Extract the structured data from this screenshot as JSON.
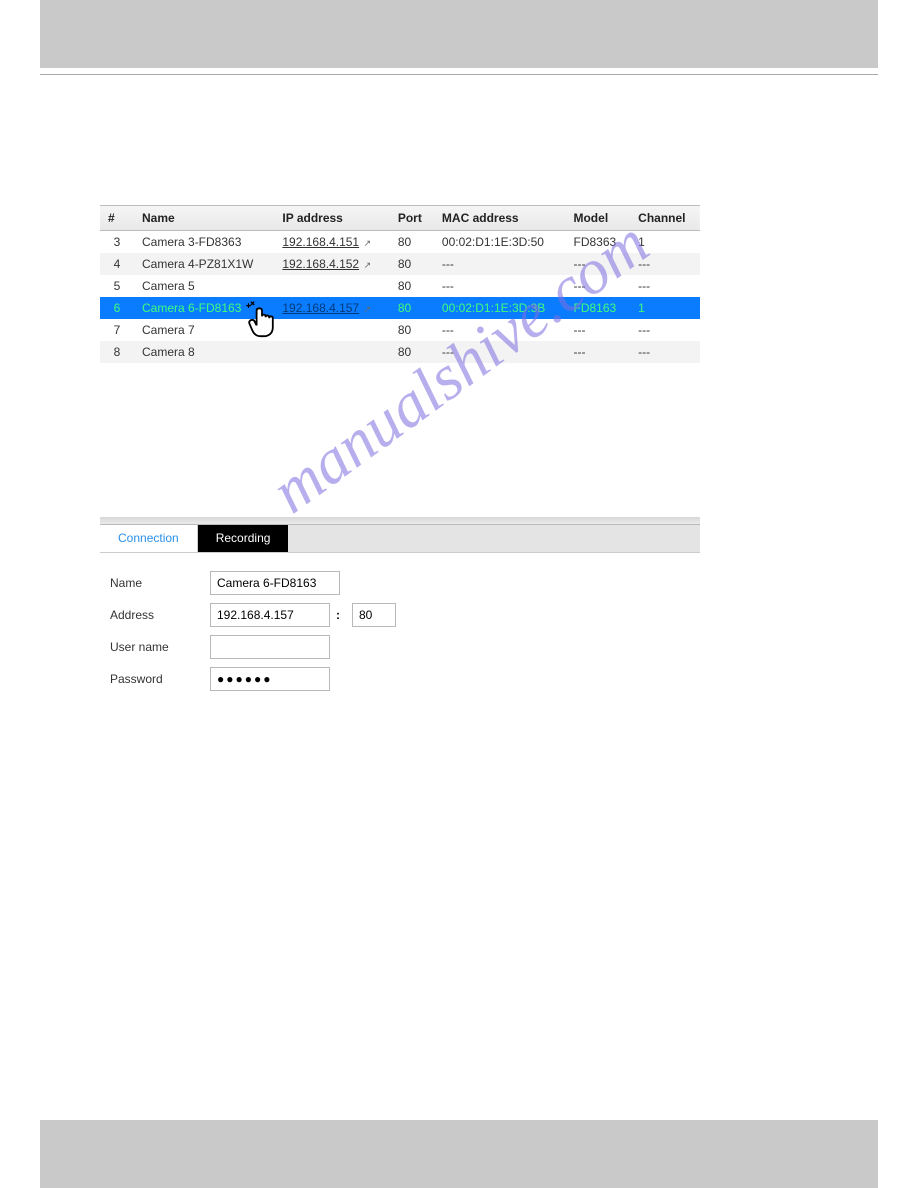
{
  "watermark": "manualshive.com",
  "table": {
    "headers": {
      "idx": "#",
      "name": "Name",
      "ip": "IP address",
      "port": "Port",
      "mac": "MAC address",
      "model": "Model",
      "channel": "Channel"
    },
    "rows": [
      {
        "idx": "3",
        "name": "Camera 3-FD8363",
        "ip": "192.168.4.151",
        "port": "80",
        "mac": "00:02:D1:1E:3D:50",
        "model": "FD8363",
        "channel": "1",
        "selected": false,
        "even": false
      },
      {
        "idx": "4",
        "name": "Camera 4-PZ81X1W",
        "ip": "192.168.4.152",
        "port": "80",
        "mac": "---",
        "model": "---",
        "channel": "---",
        "selected": false,
        "even": true
      },
      {
        "idx": "5",
        "name": "Camera 5",
        "ip": "",
        "port": "80",
        "mac": "---",
        "model": "---",
        "channel": "---",
        "selected": false,
        "even": false
      },
      {
        "idx": "6",
        "name": "Camera 6-FD8163",
        "ip": "192.168.4.157",
        "port": "80",
        "mac": "00:02:D1:1E:3D:3B",
        "model": "FD8163",
        "channel": "1",
        "selected": true,
        "even": true
      },
      {
        "idx": "7",
        "name": "Camera 7",
        "ip": "",
        "port": "80",
        "mac": "---",
        "model": "---",
        "channel": "---",
        "selected": false,
        "even": false
      },
      {
        "idx": "8",
        "name": "Camera 8",
        "ip": "",
        "port": "80",
        "mac": "---",
        "model": "---",
        "channel": "---",
        "selected": false,
        "even": true
      }
    ]
  },
  "tabs": {
    "connection": "Connection",
    "recording": "Recording"
  },
  "form": {
    "labels": {
      "name": "Name",
      "address": "Address",
      "username": "User name",
      "password": "Password"
    },
    "values": {
      "name": "Camera 6-FD8163",
      "address": "192.168.4.157",
      "port": "80",
      "username": "",
      "password": "●●●●●●"
    },
    "placeholders": {
      "username": ""
    }
  }
}
